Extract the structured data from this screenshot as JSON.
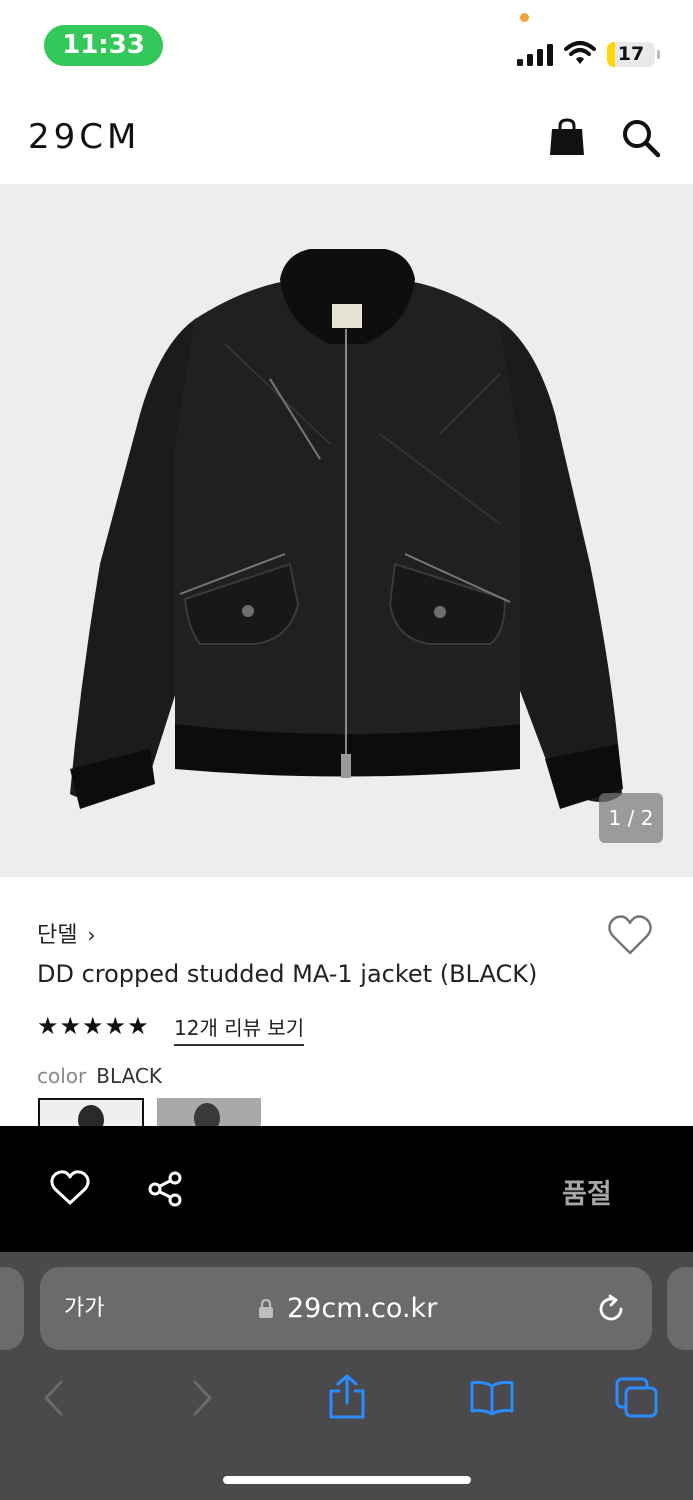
{
  "status_bar": {
    "time": "11:33",
    "battery": "17",
    "battery_level": 0.17
  },
  "header": {
    "logo": "29CM",
    "icons": [
      "shopping-bag-icon",
      "search-icon"
    ]
  },
  "gallery": {
    "counter": "1 / 2",
    "current": 1,
    "total": 2
  },
  "product": {
    "brand": "단델",
    "brand_chevron": "›",
    "name": "DD cropped studded MA-1 jacket (BLACK)",
    "stars": "★★★★★",
    "rating": 5,
    "review_link": "12개 리뷰 보기",
    "color_label": "color",
    "color_value": "BLACK"
  },
  "action_bar": {
    "status": "품절",
    "icons": [
      "heart-icon",
      "share-icon"
    ]
  },
  "browser": {
    "text_size": "가가",
    "url": "29cm.co.kr"
  },
  "colors": {
    "sold_out": "#a6a6a6",
    "status_pill": "#34c759",
    "battery": "#ffd60a"
  }
}
